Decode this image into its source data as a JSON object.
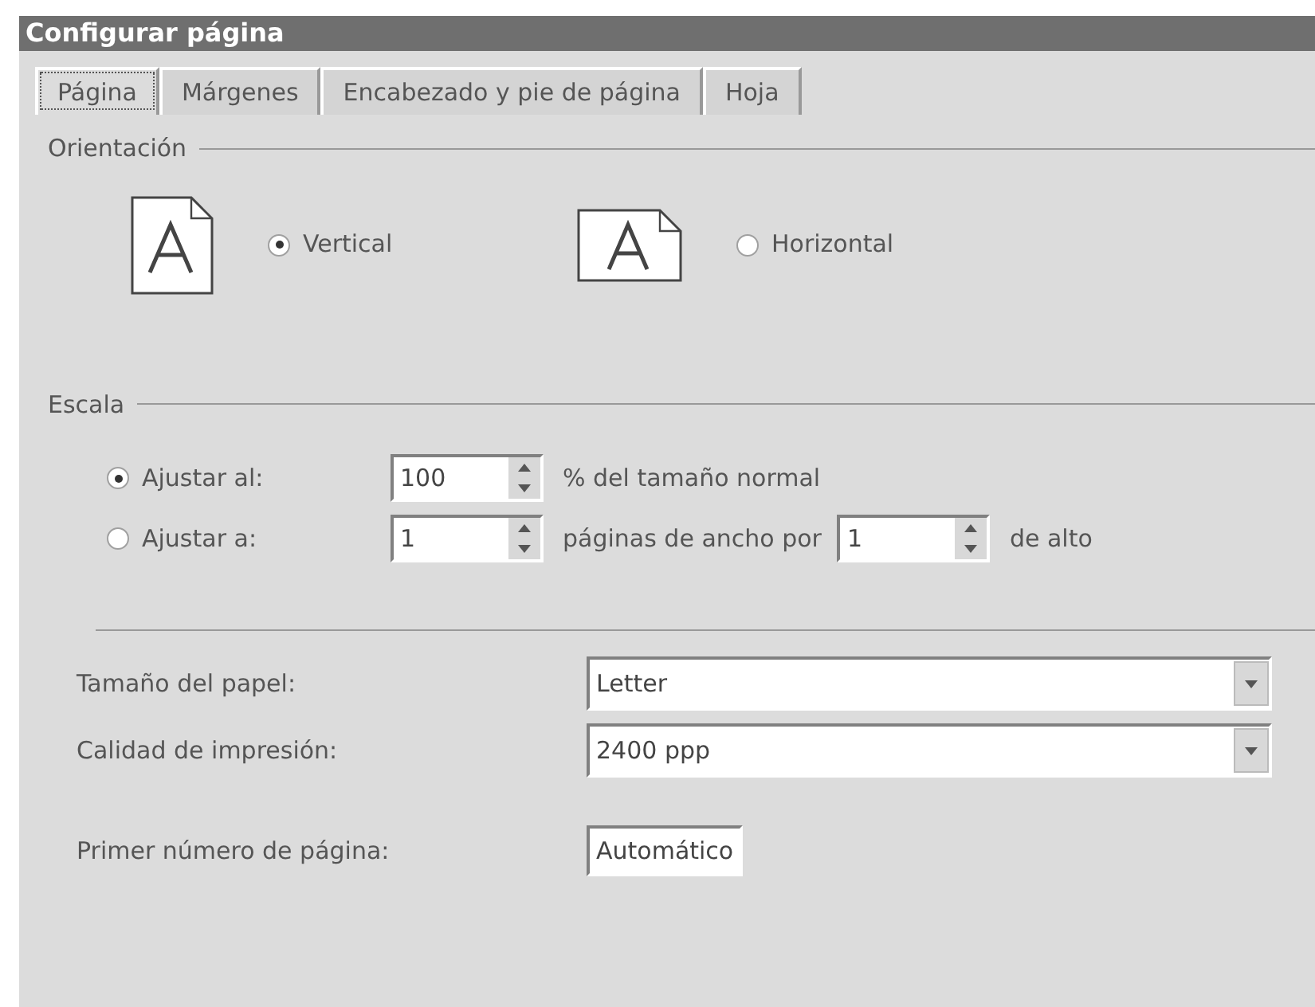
{
  "window": {
    "title": "Configurar página"
  },
  "tabs": [
    {
      "label": "Página",
      "selected": true
    },
    {
      "label": "Márgenes",
      "selected": false
    },
    {
      "label": "Encabezado y pie de página",
      "selected": false
    },
    {
      "label": "Hoja",
      "selected": false
    }
  ],
  "orientation": {
    "legend": "Orientación",
    "options": [
      {
        "label": "Vertical",
        "selected": true,
        "kind": "portrait"
      },
      {
        "label": "Horizontal",
        "selected": false,
        "kind": "landscape"
      }
    ]
  },
  "scale": {
    "legend": "Escala",
    "rows": [
      {
        "label": "Ajustar al:",
        "selected": true,
        "fields": [
          {
            "value": "100",
            "after": "% del tamaño normal"
          }
        ]
      },
      {
        "label": "Ajustar a:",
        "selected": false,
        "fields": [
          {
            "value": "1",
            "after": "páginas de ancho por"
          },
          {
            "value": "1",
            "after": "de alto"
          }
        ]
      }
    ]
  },
  "paper_size": {
    "label": "Tamaño del papel:",
    "value": "Letter"
  },
  "print_quality": {
    "label": "Calidad de impresión:",
    "value": "2400 ppp"
  },
  "first_page_number": {
    "label": "Primer número de página:",
    "value": "Automático"
  }
}
